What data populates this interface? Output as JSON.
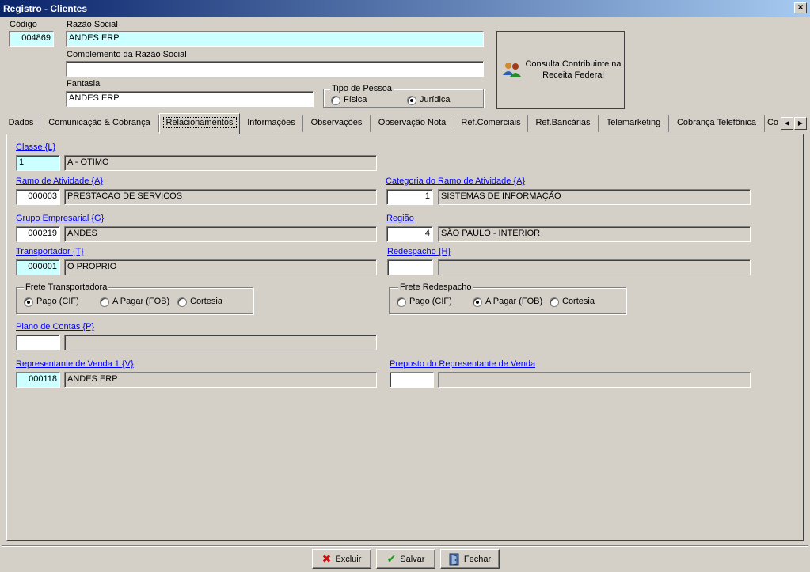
{
  "window": {
    "title": "Registro - Clientes",
    "close_glyph": "×"
  },
  "header": {
    "codigo_label": "Código",
    "codigo_value": "004869",
    "razao_label": "Razão Social",
    "razao_value": "ANDES ERP",
    "complemento_label": "Complemento da Razão Social",
    "complemento_value": "",
    "fantasia_label": "Fantasia",
    "fantasia_value": "ANDES ERP",
    "tipo_pessoa": {
      "legend": "Tipo de Pessoa",
      "fisica": "Física",
      "juridica": "Jurídica",
      "selected": "Jurídica"
    },
    "consulta_button": "Consulta Contribuinte na Receita Federal"
  },
  "tabs": [
    "Dados",
    "Comunicação & Cobrança",
    "Relacionamentos",
    "Informações",
    "Observações",
    "Observação Nota",
    "Ref.Comerciais",
    "Ref.Bancárias",
    "Telemarketing",
    "Cobrança Telefônica",
    "Co"
  ],
  "active_tab": "Relacionamentos",
  "relacionamentos": {
    "classe": {
      "label": "Classe {L}",
      "code": "1",
      "desc": "A - OTIMO"
    },
    "ramo": {
      "label": "Ramo de Atividade {A}",
      "code": "000003",
      "desc": "PRESTACAO DE SERVICOS"
    },
    "categoria": {
      "label": "Categoria do Ramo de Atividade {A}",
      "code": "1",
      "desc": "SISTEMAS DE INFORMAÇÃO"
    },
    "grupo": {
      "label": "Grupo Empresarial {G}",
      "code": "000219",
      "desc": "ANDES"
    },
    "regiao": {
      "label": "Região",
      "code": "4",
      "desc": "SÃO PAULO - INTERIOR"
    },
    "transportador": {
      "label": "Transportador {T}",
      "code": "000001",
      "desc": "O PROPRIO"
    },
    "redespacho": {
      "label": "Redespacho {H}",
      "code": "",
      "desc": ""
    },
    "frete_transportadora": {
      "legend": "Frete Transportadora",
      "pago": "Pago (CIF)",
      "apagar": "A Pagar (FOB)",
      "cortesia": "Cortesia",
      "selected": "Pago (CIF)"
    },
    "frete_redespacho": {
      "legend": "Frete Redespacho",
      "pago": "Pago (CIF)",
      "apagar": "A Pagar (FOB)",
      "cortesia": "Cortesia",
      "selected": "A Pagar (FOB)"
    },
    "plano": {
      "label": "Plano de Contas {P}",
      "code": "",
      "desc": ""
    },
    "representante": {
      "label": "Representante de Venda 1 {V}",
      "code": "000118",
      "desc": "ANDES ERP"
    },
    "preposto": {
      "label": "Preposto do Representante de Venda",
      "code": "",
      "desc": ""
    }
  },
  "buttons": {
    "excluir": "Excluir",
    "salvar": "Salvar",
    "fechar": "Fechar"
  },
  "colors": {
    "title_start": "#0a246a",
    "title_end": "#a6caf0",
    "face": "#d4d0c8",
    "highlight_field": "#ccffff",
    "link": "#0000ff"
  }
}
